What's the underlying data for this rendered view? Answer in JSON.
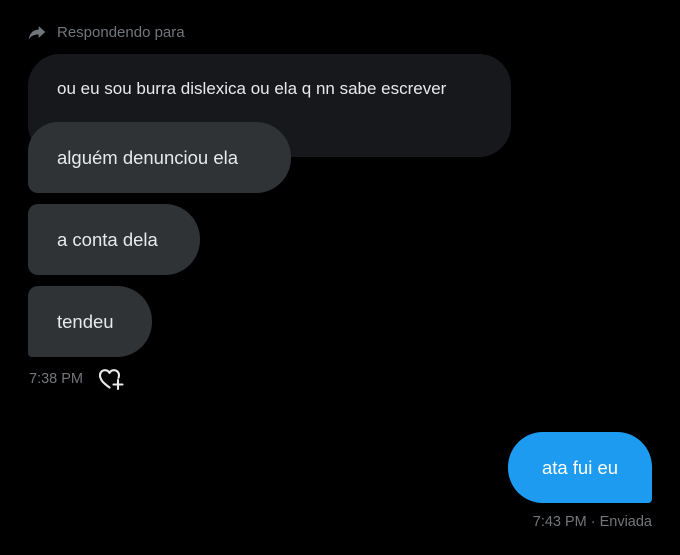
{
  "reply_header": {
    "icon": "reply-arrow-icon",
    "label": "Respondendo para"
  },
  "quoted_message": {
    "text": "ou eu sou burra dislexica ou ela q nn sabe escrever"
  },
  "received_messages": [
    {
      "text": "alguém denunciou ela"
    },
    {
      "text": "a conta dela"
    },
    {
      "text": "tendeu"
    }
  ],
  "received_meta": {
    "time": "7:38 PM",
    "reaction_icon": "heart-plus-icon"
  },
  "sent_message": {
    "text": "ata fui eu"
  },
  "sent_meta": {
    "time": "7:43 PM",
    "separator": "·",
    "status": "Enviada"
  },
  "colors": {
    "background": "#000000",
    "received_bubble": "#2f3336",
    "quoted_bubble": "#16181c",
    "sent_bubble": "#1d9bf0",
    "muted_text": "#71767b",
    "text": "#e7e9ea"
  }
}
